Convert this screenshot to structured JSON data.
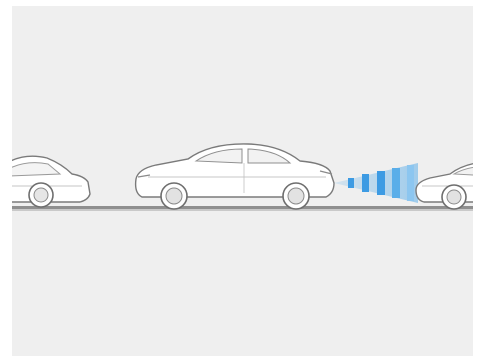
{
  "scene": {
    "description_colors": {
      "background": "#efefef",
      "car_body": "#ffffff",
      "car_outline": "#7a7a7a",
      "road": "#8f8f8f",
      "sensor_beam": "#3fa0e6"
    },
    "vehicles": [
      "rear-vehicle",
      "own-vehicle",
      "front-vehicle"
    ],
    "sensor_beam_bars": 5
  }
}
